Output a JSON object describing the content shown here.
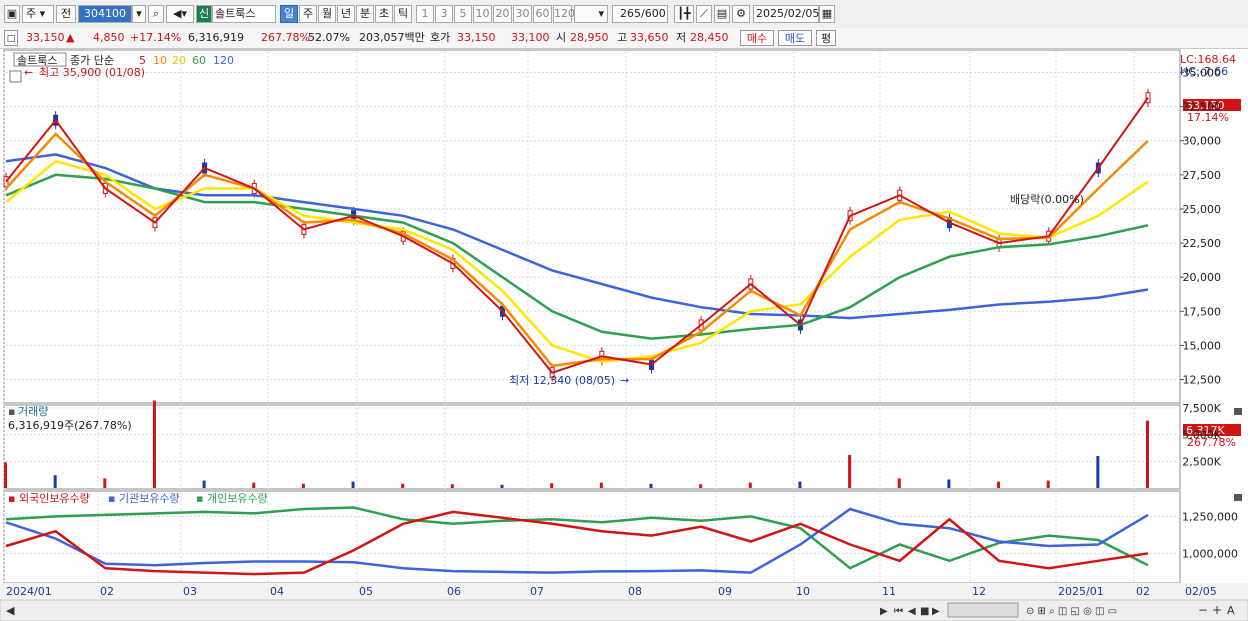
{
  "toolbar": {
    "market": "주",
    "prev": "전",
    "stock_code": "304100",
    "badge": "신",
    "stock_name": "솔트룩스",
    "periods": [
      "일",
      "주",
      "월",
      "년",
      "분",
      "초",
      "틱"
    ],
    "selected_period": "일",
    "intervals": [
      "1",
      "3",
      "5",
      "10",
      "20",
      "30",
      "60",
      "120"
    ],
    "count_current": "265",
    "count_total": "/600",
    "date": "2025/02/05"
  },
  "info": {
    "price": "33,150",
    "arrow": "▲",
    "change": "4,850",
    "change_pct": "+17.14%",
    "volume": "6,316,919",
    "volume_pct": "267.78%",
    "turnover": "52.07%",
    "amount": "203,057백만",
    "quote_label": "호가",
    "ask": "33,150",
    "bid": "33,100",
    "open_label": "시",
    "open": "28,950",
    "high_label": "고",
    "high": "33,650",
    "low_label": "저",
    "low": "28,450",
    "buy_label": "매수",
    "sell_label": "매도",
    "eval_label": "평"
  },
  "legend": {
    "name": "솔트룩스",
    "ma_prefix": "종가 단순",
    "ma5": "5",
    "ma10": "10",
    "ma20": "20",
    "ma60": "60",
    "ma120": "120",
    "ma5_color": "#d21414",
    "ma10_color": "#f58a00",
    "ma20_color": "#ffe600",
    "ma60_color": "#2ea04e",
    "ma120_color": "#3c64dc",
    "high_note": "최고 35,900 (01/08)",
    "low_note": "최저 12,340 (08/05)",
    "lc": "LC:168.64",
    "hc": "HC:-7.66",
    "price_label": "33,150",
    "price_pct": "17.14%",
    "annotation": "배당락(0.00%)"
  },
  "volume_panel": {
    "title": "거래량",
    "value": "6,316,919주(267.78%)",
    "current": "6,317K",
    "pct": "267.78%"
  },
  "holdings_panel": {
    "foreign": "외국인보유수량",
    "institution": "기관보유수량",
    "individual": "개인보유수량",
    "foreign_color": "#d21414",
    "institution_color": "#3c64dc",
    "individual_color": "#2ea04e"
  },
  "price_axis": [
    "35,000",
    "32,500",
    "30,000",
    "27,500",
    "25,000",
    "22,500",
    "20,000",
    "17,500",
    "15,000",
    "12,500"
  ],
  "volume_axis": [
    "7,500K",
    "5,000K",
    "2,500K"
  ],
  "holdings_axis": [
    "1,250,000",
    "1,000,000"
  ],
  "x_axis": [
    "2024/01",
    "02",
    "03",
    "04",
    "05",
    "06",
    "07",
    "08",
    "09",
    "10",
    "11",
    "12",
    "2025/01",
    "02",
    "02/05"
  ],
  "chart_data": {
    "type": "line",
    "title": "솔트룩스",
    "ylim": [
      11000,
      36500
    ],
    "x": [
      "2024/01",
      "02",
      "03",
      "04",
      "05",
      "06",
      "07",
      "08",
      "09",
      "10",
      "11",
      "12",
      "2025/01",
      "02",
      "02/05"
    ],
    "series": [
      {
        "name": "5",
        "values": [
          27000,
          31500,
          26500,
          24000,
          28000,
          26500,
          23500,
          24500,
          23000,
          21000,
          17500,
          13000,
          14200,
          13600,
          16500,
          19500,
          16500,
          24500,
          26000,
          24000,
          22500,
          23000,
          28000,
          33150
        ]
      },
      {
        "name": "10",
        "values": [
          26500,
          30500,
          27000,
          24500,
          27500,
          26500,
          24000,
          24200,
          23200,
          21300,
          18000,
          13500,
          14000,
          14000,
          16000,
          19000,
          17200,
          23500,
          25500,
          24300,
          22800,
          22900,
          26500,
          30000
        ]
      },
      {
        "name": "20",
        "values": [
          25500,
          28500,
          27500,
          25000,
          26500,
          26500,
          24500,
          24000,
          23500,
          22000,
          19000,
          15000,
          13800,
          14200,
          15200,
          17500,
          18000,
          21500,
          24200,
          24800,
          23200,
          22900,
          24500,
          27000
        ]
      },
      {
        "name": "60",
        "values": [
          26000,
          27500,
          27200,
          26500,
          25500,
          25500,
          25000,
          24500,
          24000,
          22500,
          20000,
          17500,
          16000,
          15500,
          15800,
          16200,
          16500,
          17800,
          20000,
          21500,
          22200,
          22400,
          23000,
          23800
        ]
      },
      {
        "name": "120",
        "values": [
          28500,
          29000,
          28000,
          26500,
          26000,
          26000,
          25500,
          25000,
          24500,
          23500,
          22000,
          20500,
          19500,
          18500,
          17800,
          17300,
          17200,
          17000,
          17300,
          17600,
          18000,
          18200,
          18500,
          19100
        ]
      }
    ]
  }
}
